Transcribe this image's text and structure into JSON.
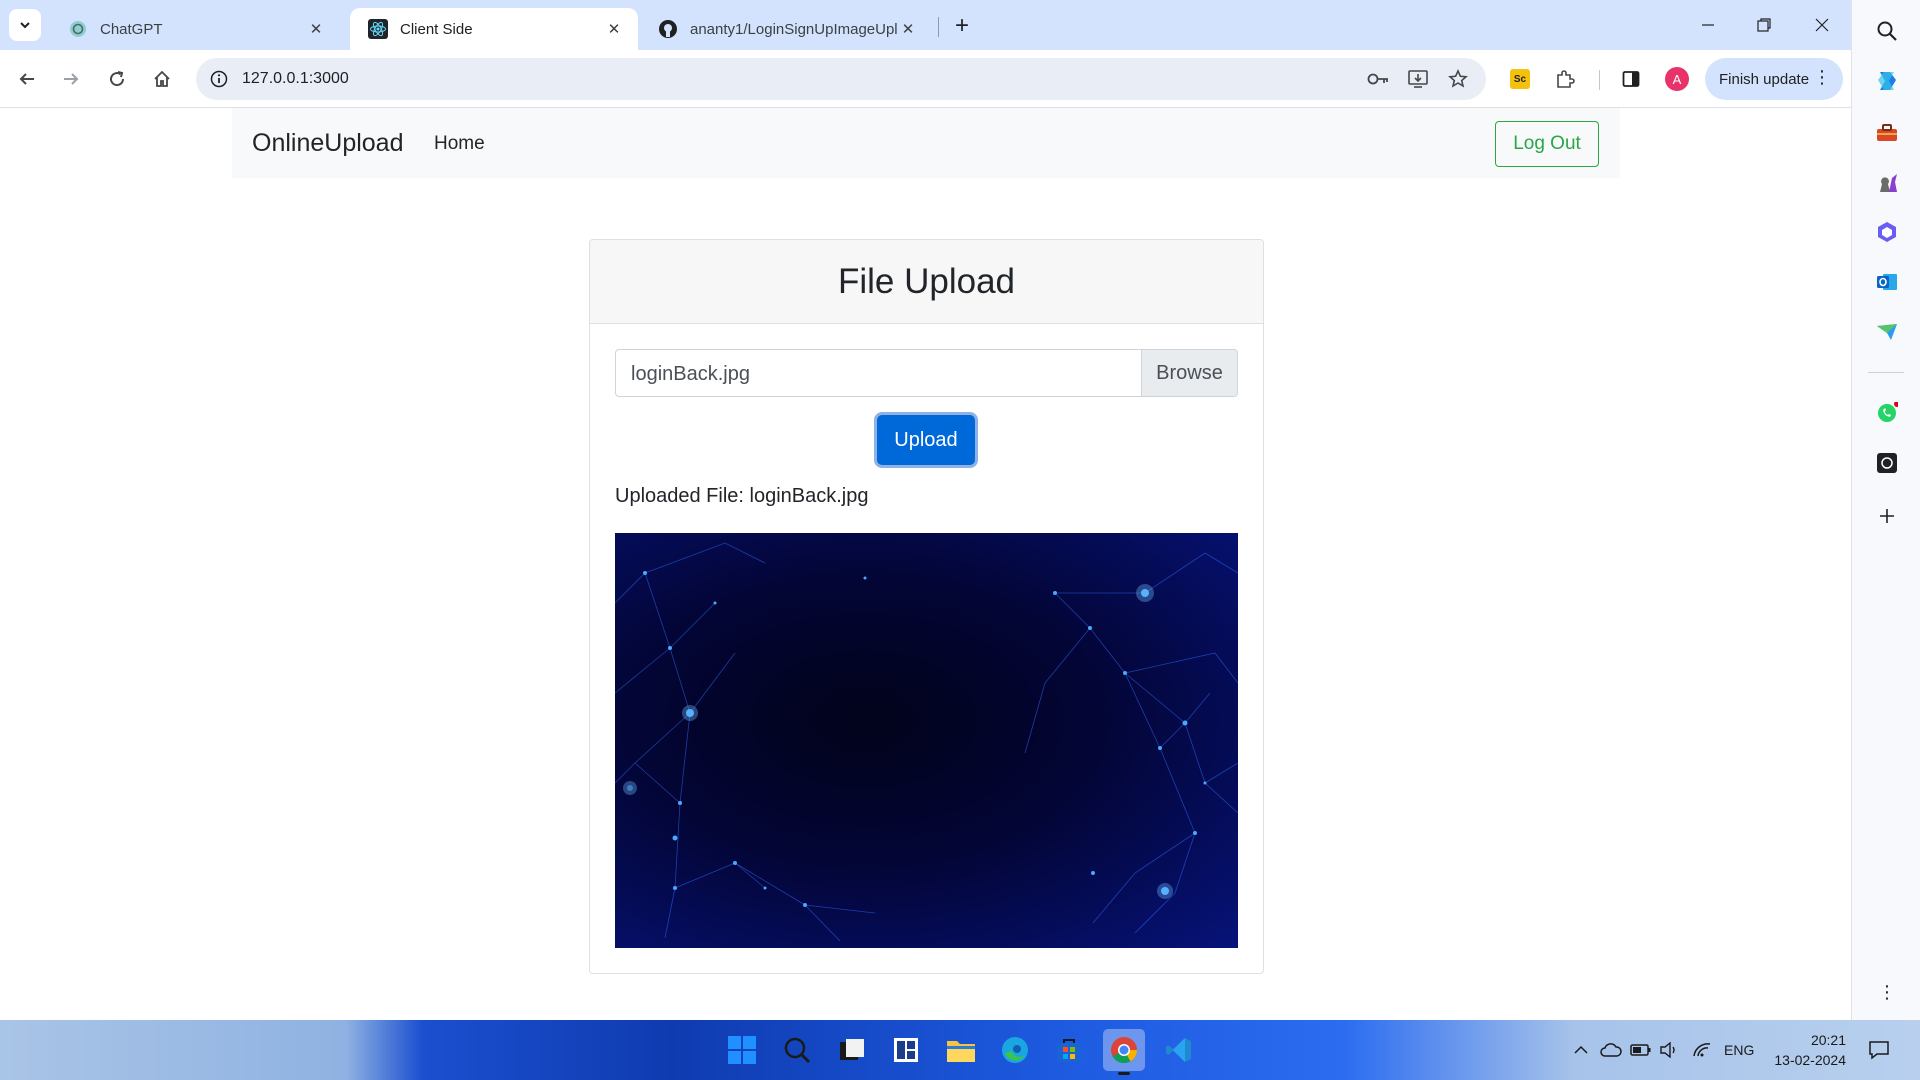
{
  "browser": {
    "tabs": [
      {
        "title": "ChatGPT",
        "icon": "chatgpt-icon",
        "active": false
      },
      {
        "title": "Client Side",
        "icon": "react-icon",
        "active": true
      },
      {
        "title": "ananty1/LoginSignUpImageUpl",
        "icon": "github-icon",
        "active": false
      }
    ],
    "url": "127.0.0.1:3000",
    "finish_update_label": "Finish update",
    "profile_initial": "A",
    "extension_label": "Sc"
  },
  "page": {
    "brand": "OnlineUpload",
    "nav_home": "Home",
    "logout_label": "Log Out",
    "card_title": "File Upload",
    "file_input_value": "loginBack.jpg",
    "browse_label": "Browse",
    "upload_label": "Upload",
    "uploaded_text": "Uploaded File: loginBack.jpg",
    "colors": {
      "primary": "#0069d9",
      "success": "#28a745",
      "tab_strip": "#d3e3fd"
    }
  },
  "taskbar": {
    "language": "ENG",
    "time": "20:21",
    "date": "13-02-2024",
    "apps": [
      "windows-start-icon",
      "search-icon",
      "task-view-icon",
      "widgets-icon",
      "file-explorer-icon",
      "edge-icon",
      "store-icon",
      "chrome-icon",
      "vscode-icon"
    ]
  }
}
